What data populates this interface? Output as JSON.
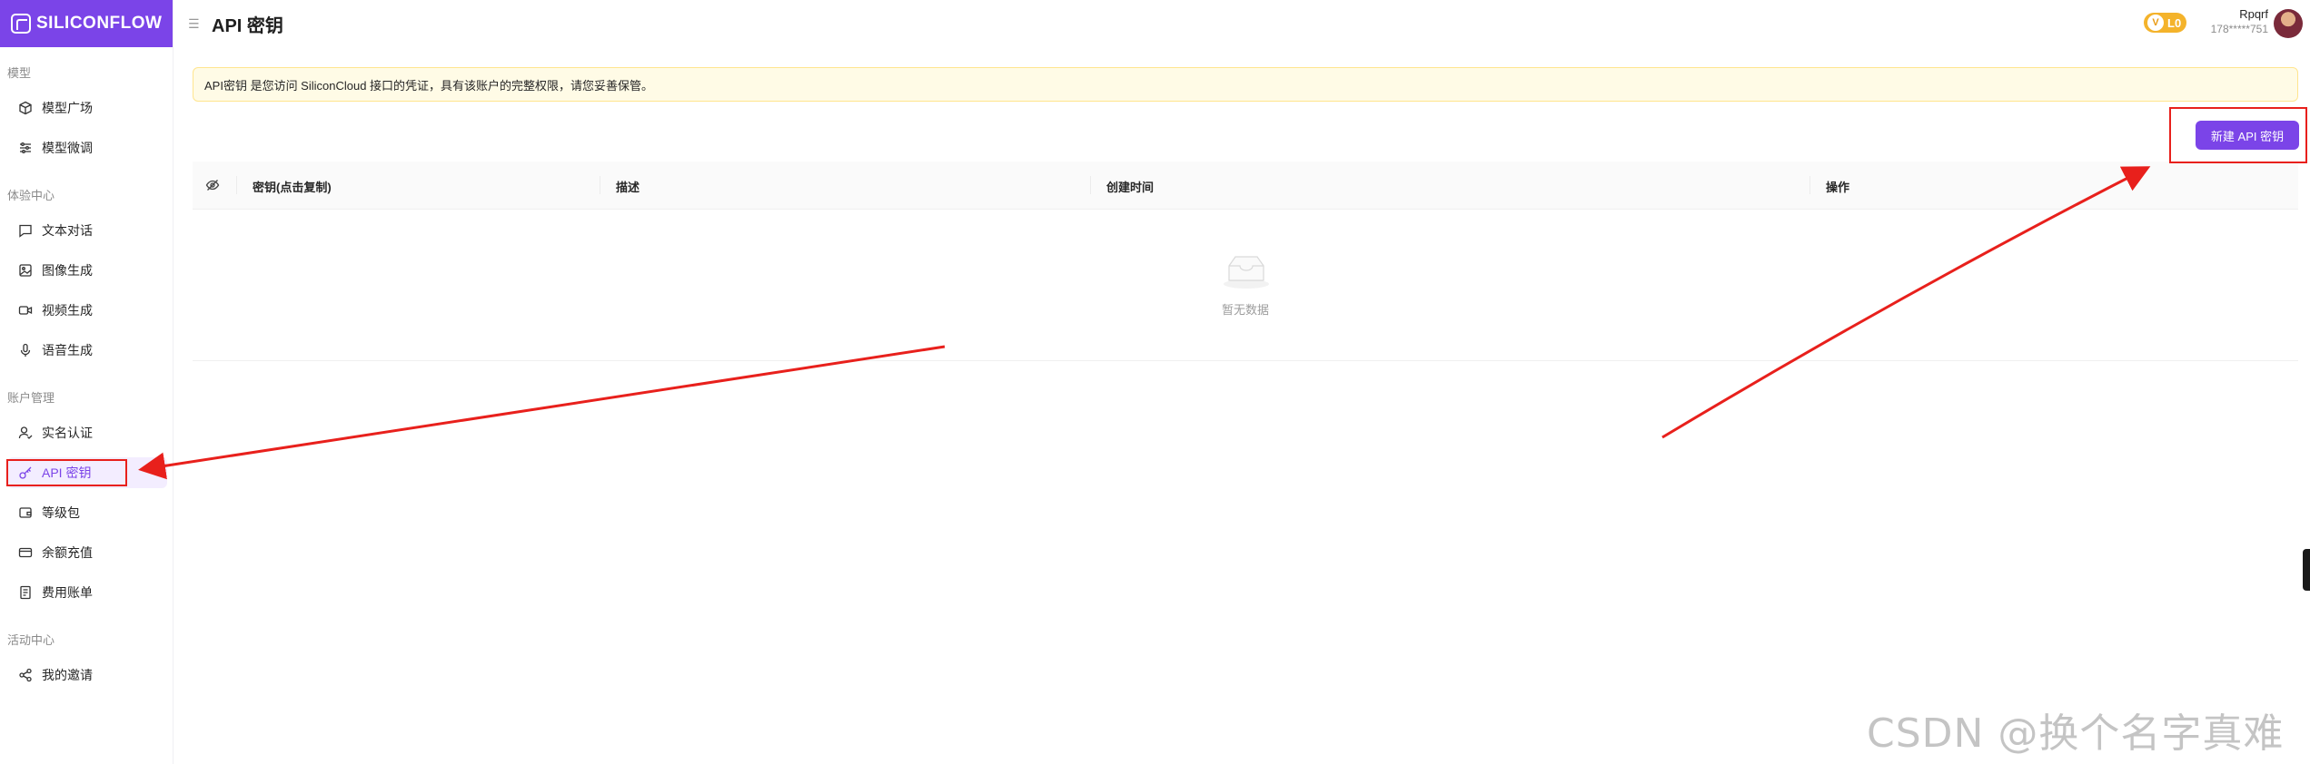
{
  "brand": {
    "name": "SILICONFLOW"
  },
  "sidebar": {
    "sections": [
      {
        "label": "模型",
        "items": [
          {
            "label": "模型广场",
            "icon": "cube-icon"
          },
          {
            "label": "模型微调",
            "icon": "sliders-icon"
          }
        ]
      },
      {
        "label": "体验中心",
        "items": [
          {
            "label": "文本对话",
            "icon": "chat-icon"
          },
          {
            "label": "图像生成",
            "icon": "image-icon"
          },
          {
            "label": "视频生成",
            "icon": "video-icon"
          },
          {
            "label": "语音生成",
            "icon": "mic-icon"
          }
        ]
      },
      {
        "label": "账户管理",
        "items": [
          {
            "label": "实名认证",
            "icon": "user-check-icon"
          },
          {
            "label": "API 密钥",
            "icon": "key-icon",
            "active": true
          },
          {
            "label": "等级包",
            "icon": "wallet-icon"
          },
          {
            "label": "余额充值",
            "icon": "card-icon"
          },
          {
            "label": "费用账单",
            "icon": "receipt-icon"
          }
        ]
      },
      {
        "label": "活动中心",
        "items": [
          {
            "label": "我的邀请",
            "icon": "share-icon"
          }
        ]
      }
    ]
  },
  "header": {
    "title": "API 密钥",
    "vip_level": "L0",
    "vip_letter": "V",
    "username": "Rpqrf",
    "phone": "178*****751"
  },
  "notice": {
    "text": "API密钥 是您访问 SiliconCloud 接口的凭证，具有该账户的完整权限，请您妥善保管。"
  },
  "actions": {
    "create_label": "新建 API 密钥"
  },
  "table": {
    "columns": [
      "密钥(点击复制)",
      "描述",
      "创建时间",
      "操作"
    ],
    "rows": [],
    "empty_text": "暂无数据"
  },
  "watermark": "CSDN @换个名字真难",
  "colors": {
    "accent": "#7b44e8",
    "annotation": "#e8201c",
    "notice_bg": "#fffbe6",
    "vip": "#f4b32b"
  }
}
